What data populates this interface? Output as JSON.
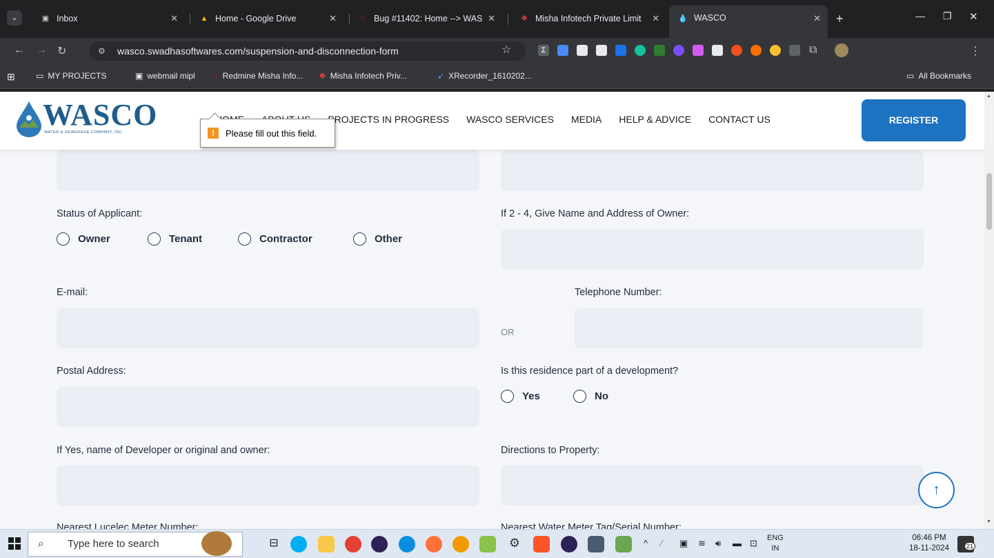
{
  "browser": {
    "tabs": [
      {
        "label": "Inbox",
        "icon": "mail-icon"
      },
      {
        "label": "Home - Google Drive",
        "icon": "drive-icon"
      },
      {
        "label": "Bug #11402: Home --> WAS",
        "icon": "redmine-icon"
      },
      {
        "label": "Misha Infotech Private Limit",
        "icon": "misha-icon"
      },
      {
        "label": "WASCO",
        "icon": "wasco-icon"
      }
    ],
    "url": "wasco.swadhasoftwares.com/suspension-and-disconnection-form",
    "bookmarks": [
      "MY PROJECTS",
      "webmail mipl",
      "Redmine Misha Info...",
      "Misha Infotech Priv...",
      "XRecorder_1610202..."
    ],
    "all_bookmarks": "All Bookmarks"
  },
  "site": {
    "logo_text": "WASCO",
    "logo_sub": "WATER & SEWERAGE COMPANY, INC.",
    "nav": [
      "HOME",
      "ABOUT US",
      "PROJECTS IN PROGRESS",
      "WASCO SERVICES",
      "MEDIA",
      "HELP & ADVICE",
      "CONTACT US"
    ],
    "register": "REGISTER",
    "tooltip": "Please fill out this field."
  },
  "form": {
    "status_label": "Status of Applicant:",
    "status_options": [
      "Owner",
      "Tenant",
      "Contractor",
      "Other"
    ],
    "owner_label": "If 2 - 4, Give Name and Address of Owner:",
    "email_label": "E-mail:",
    "or_text": "OR",
    "phone_label": "Telephone Number:",
    "postal_label": "Postal Address:",
    "development_label": "Is this residence part of a development?",
    "development_options": [
      "Yes",
      "No"
    ],
    "developer_label": "If Yes, name of Developer or original and owner:",
    "directions_label": "Directions to Property:",
    "lucelec_label": "Nearest Lucelec Meter Number:",
    "water_meter_label": "Nearest Water Meter Tag/Serial Number:"
  },
  "taskbar": {
    "search_placeholder": "Type here to search",
    "lang": "ENG",
    "region": "IN",
    "time": "06:46 PM",
    "date": "18-11-2024",
    "notifications": "21"
  },
  "colors": {
    "brand": "#1d73c1",
    "field_bg": "#eaedf3",
    "page_bg": "#f5f6fa"
  }
}
